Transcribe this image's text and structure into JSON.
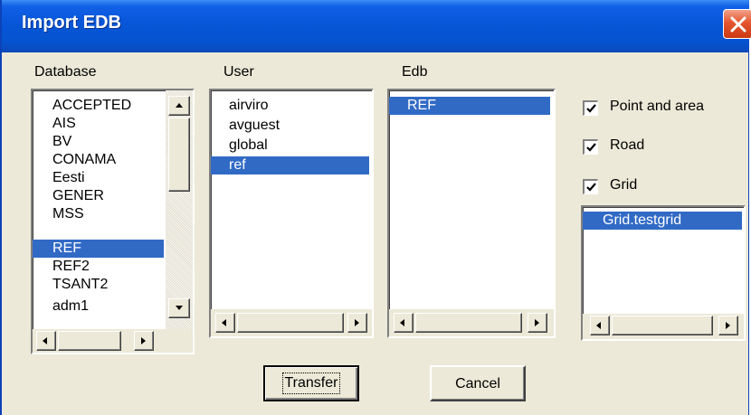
{
  "window": {
    "title": "Import EDB"
  },
  "database": {
    "label": "Database",
    "items": [
      "ACCEPTED",
      "AIS",
      "BV",
      "CONAMA",
      "Eesti",
      "GENER",
      "MSS",
      "REF",
      "REF2",
      "TSANT2",
      "adm1"
    ],
    "selected": "REF"
  },
  "user": {
    "label": "User",
    "items": [
      "airviro",
      "avguest",
      "global",
      "ref"
    ],
    "selected": "ref"
  },
  "edb": {
    "label": "Edb",
    "items": [
      "REF"
    ],
    "selected": "REF"
  },
  "options": {
    "point_and_area": {
      "label": "Point and area",
      "checked": true
    },
    "road": {
      "label": "Road",
      "checked": true
    },
    "grid": {
      "label": "Grid",
      "checked": true
    }
  },
  "grid_list": {
    "items": [
      "Grid.testgrid"
    ],
    "selected": "Grid.testgrid"
  },
  "buttons": {
    "transfer": "Transfer",
    "cancel": "Cancel"
  },
  "colors": {
    "selection": "#316ac5",
    "titlebar": "#0756d8",
    "dialog_bg": "#ece9d8"
  }
}
